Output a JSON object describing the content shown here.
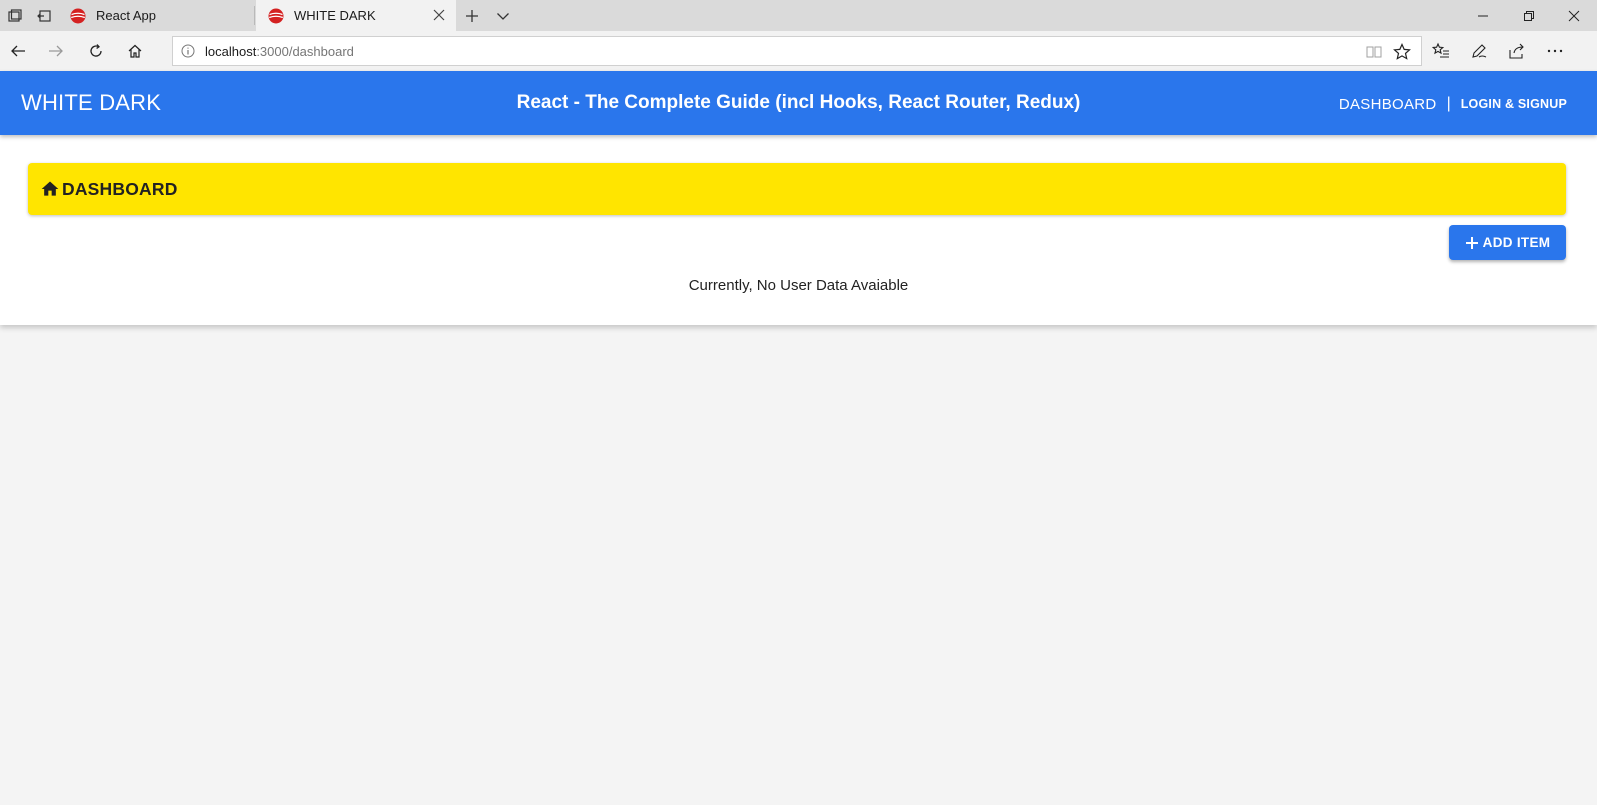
{
  "browser": {
    "tabs": [
      {
        "title": "React App",
        "active": false
      },
      {
        "title": "WHITE DARK",
        "active": true
      }
    ],
    "url_host": "localhost",
    "url_path": ":3000/dashboard"
  },
  "header": {
    "brand": "WHITE DARK",
    "course_title": "React - The Complete Guide (incl Hooks, React Router, Redux)",
    "nav_dashboard": "DASHBOARD",
    "nav_separator": "|",
    "nav_login": "LOGIN & SIGNUP"
  },
  "dashboard": {
    "title": "DASHBOARD",
    "add_button_label": "ADD ITEM",
    "empty_message": "Currently, No User Data Avaiable"
  },
  "colors": {
    "primary": "#2a76ec",
    "banner": "#ffe500",
    "page_bg": "#f4f4f4"
  }
}
